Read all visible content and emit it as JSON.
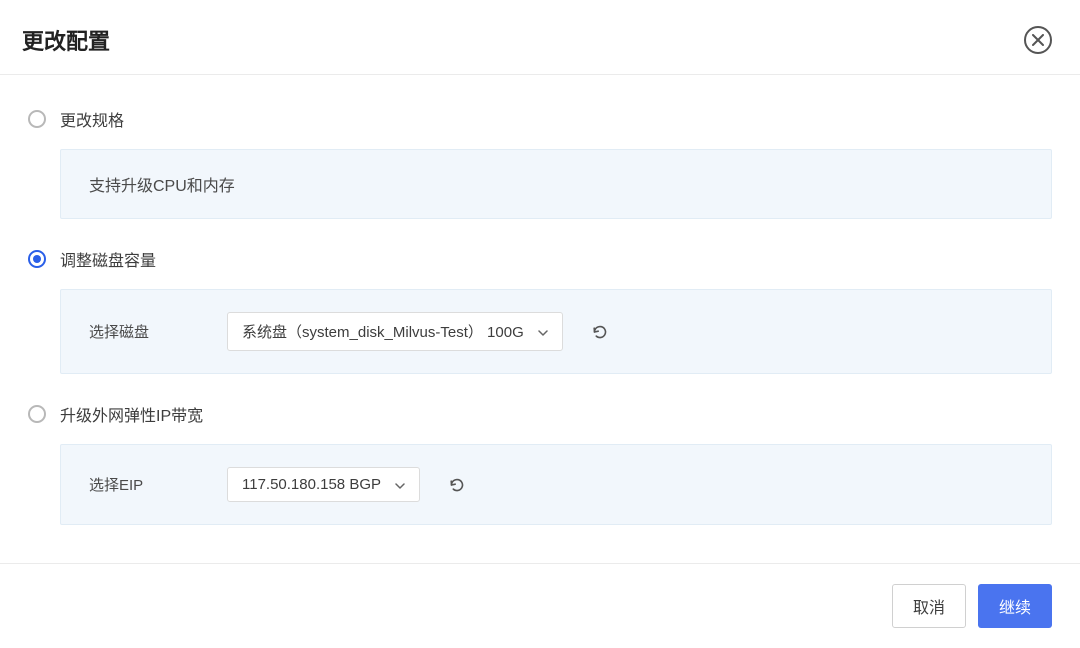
{
  "header": {
    "title": "更改配置"
  },
  "options": {
    "spec": {
      "label": "更改规格",
      "desc": "支持升级CPU和内存",
      "selected": false
    },
    "disk": {
      "label": "调整磁盘容量",
      "select_label": "选择磁盘",
      "dropdown_value": "系统盘（system_disk_Milvus-Test） 100G",
      "selected": true
    },
    "eip": {
      "label": "升级外网弹性IP带宽",
      "select_label": "选择EIP",
      "dropdown_value": "117.50.180.158 BGP",
      "selected": false
    }
  },
  "footer": {
    "cancel": "取消",
    "continue": "继续"
  }
}
